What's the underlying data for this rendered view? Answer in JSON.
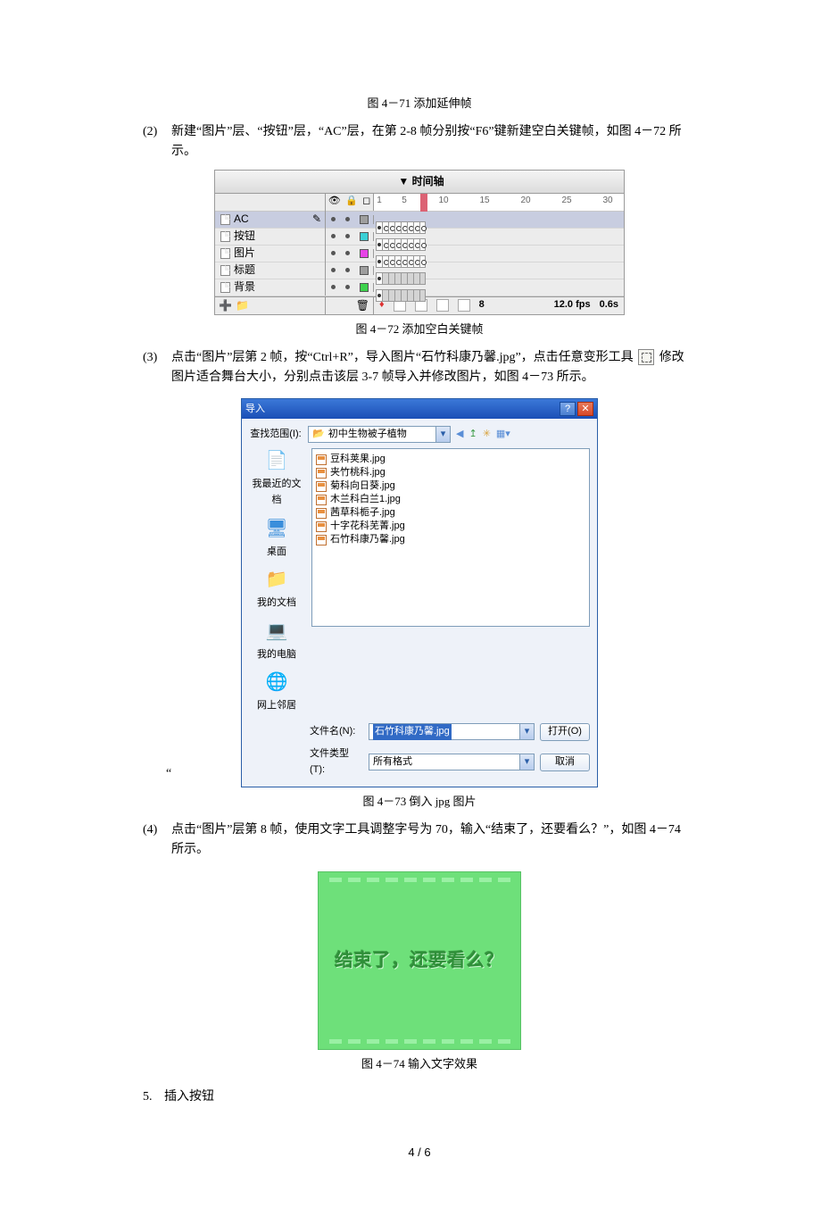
{
  "captions": {
    "c71": "图 4－71 添加延伸帧",
    "c72": "图 4－72 添加空白关键帧",
    "c73": "图 4－73 倒入 jpg 图片",
    "c74": "图 4－74 输入文字效果"
  },
  "steps": {
    "s2": {
      "num": "(2)",
      "text": "新建“图片”层、“按钮”层，“AC”层，在第 2-8 帧分别按“F6”键新建空白关键帧，如图 4－72 所示。"
    },
    "s3": {
      "num": "(3)",
      "p1": "点击“图片”层第 2 帧，按“Ctrl+R”，导入图片“石竹科康乃馨.jpg”，点击任意变形工具",
      "p2": "修改图片适合舞台大小，分别点击该层 3-7 帧导入并修改图片，如图 4－73 所示。"
    },
    "s4": {
      "num": "(4)",
      "text": "点击“图片”层第 8 帧，使用文字工具调整字号为 70，输入“结束了，还要看么？”，如图 4－74 所示。"
    }
  },
  "section5": {
    "num": "5.",
    "text": "插入按钮"
  },
  "timeline": {
    "title": "▼ 时间轴",
    "ruler": [
      "1",
      "5",
      "10",
      "15",
      "20",
      "25",
      "30"
    ],
    "layers": [
      "AC",
      "按钮",
      "图片",
      "标题",
      "背景"
    ],
    "status": {
      "frame": "8",
      "fps": "12.0 fps",
      "time": "0.6s"
    },
    "colors": [
      "#9e9e9e",
      "#3ad0d6",
      "#e744e7",
      "#9e9e9e",
      "#3dd24c"
    ]
  },
  "dialog": {
    "title": "导入",
    "look_label": "查找范围(I):",
    "folder": "初中生物被子植物",
    "places": [
      "我最近的文档",
      "桌面",
      "我的文档",
      "我的电脑",
      "网上邻居"
    ],
    "files": [
      "豆科荚果.jpg",
      "夹竹桃科.jpg",
      "菊科向日葵.jpg",
      "木兰科白兰1.jpg",
      "茜草科栀子.jpg",
      "十字花科芜菁.jpg",
      "石竹科康乃馨.jpg"
    ],
    "filename_label": "文件名(N):",
    "filetype_label": "文件类型(T):",
    "filename_value": "石竹科康乃馨.jpg",
    "filetype_value": "所有格式",
    "open": "打开(O)",
    "cancel": "取消"
  },
  "stage_text": "结束了，还要看么？",
  "footer": "4 / 6",
  "quote": "“"
}
